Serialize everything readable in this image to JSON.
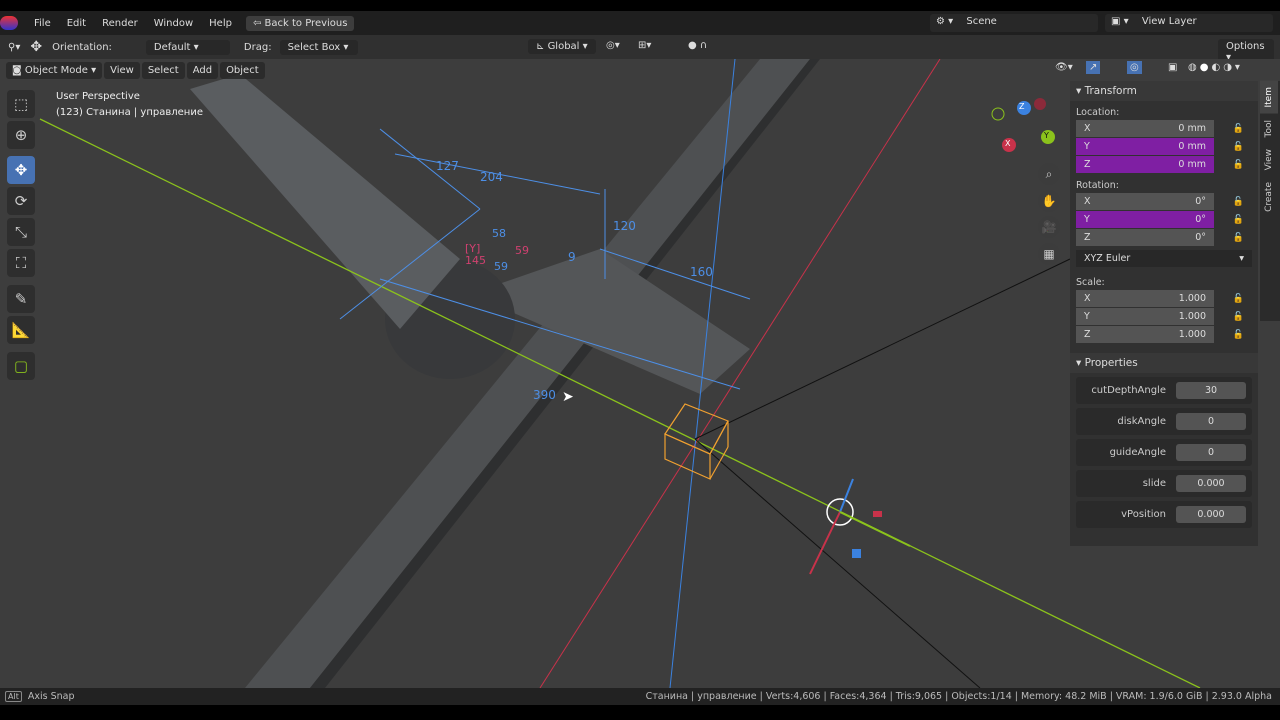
{
  "menubar": {
    "items": [
      "File",
      "Edit",
      "Render",
      "Window",
      "Help"
    ],
    "back_button": "Back to Previous",
    "scene": "Scene",
    "view_layer": "View Layer"
  },
  "toolheader": {
    "orientation_label": "Orientation:",
    "orientation_value": "Default",
    "drag_label": "Drag:",
    "drag_value": "Select Box",
    "transform_orientation": "Global",
    "options": "Options"
  },
  "viewport_header": {
    "mode": "Object Mode",
    "menus": [
      "View",
      "Select",
      "Add",
      "Object"
    ]
  },
  "overlay": {
    "view_name": "User Perspective",
    "object_info": "(123) Станина | управление"
  },
  "dimensions": [
    "127",
    "204",
    "58",
    "120",
    "9",
    "160",
    "390",
    "59",
    "145",
    "59",
    "[Y]"
  ],
  "gizmo": {
    "x": "X",
    "y": "Y",
    "z": "Z"
  },
  "transform": {
    "title": "Transform",
    "location_label": "Location:",
    "location": [
      {
        "axis": "X",
        "value": "0 mm"
      },
      {
        "axis": "Y",
        "value": "0 mm"
      },
      {
        "axis": "Z",
        "value": "0 mm"
      }
    ],
    "rotation_label": "Rotation:",
    "rotation": [
      {
        "axis": "X",
        "value": "0°"
      },
      {
        "axis": "Y",
        "value": "0°"
      },
      {
        "axis": "Z",
        "value": "0°"
      }
    ],
    "rotation_mode": "XYZ Euler",
    "scale_label": "Scale:",
    "scale": [
      {
        "axis": "X",
        "value": "1.000"
      },
      {
        "axis": "Y",
        "value": "1.000"
      },
      {
        "axis": "Z",
        "value": "1.000"
      }
    ]
  },
  "properties": {
    "title": "Properties",
    "items": [
      {
        "name": "cutDepthAngle",
        "value": "30"
      },
      {
        "name": "diskAngle",
        "value": "0"
      },
      {
        "name": "guideAngle",
        "value": "0"
      },
      {
        "name": "slide",
        "value": "0.000"
      },
      {
        "name": "vPosition",
        "value": "0.000"
      }
    ]
  },
  "tabs": [
    "Item",
    "Tool",
    "View",
    "Create"
  ],
  "statusbar": {
    "left": "Axis Snap",
    "key": "Alt",
    "stats": "Станина | управление | Verts:4,606 | Faces:4,364 | Tris:9,065 | Objects:1/14 | Memory: 48.2 MiB | VRAM: 1.9/6.0 GiB | 2.93.0 Alpha"
  },
  "colors": {
    "accent": "#4772b3",
    "highlight": "#7f1fa3",
    "x_axis": "#c8324a",
    "y_axis": "#8bc21c",
    "z_axis": "#3b82e0",
    "dimension": "#4d8fe6",
    "selection": "#f0a030"
  }
}
